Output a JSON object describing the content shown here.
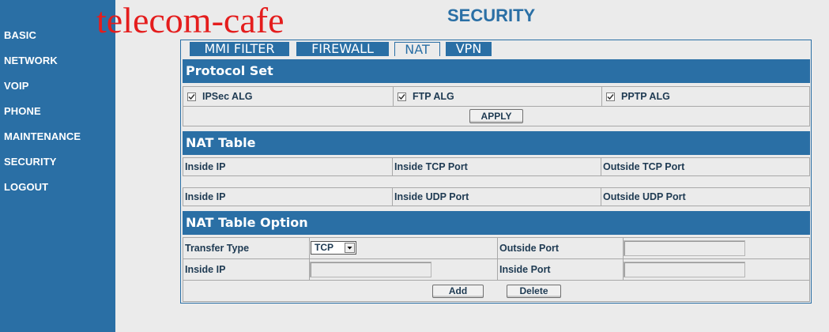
{
  "watermark": "telecom-cafe",
  "page_title": "SECURITY",
  "sidebar": {
    "items": [
      {
        "label": "BASIC"
      },
      {
        "label": "NETWORK"
      },
      {
        "label": "VOIP"
      },
      {
        "label": "PHONE"
      },
      {
        "label": "MAINTENANCE"
      },
      {
        "label": "SECURITY"
      },
      {
        "label": "LOGOUT"
      }
    ]
  },
  "tabs": [
    {
      "label": "MMI FILTER",
      "active": false
    },
    {
      "label": "FIREWALL",
      "active": false
    },
    {
      "label": "NAT",
      "active": true
    },
    {
      "label": "VPN",
      "active": false
    }
  ],
  "protocol_set": {
    "title": "Protocol Set",
    "options": [
      {
        "label": "IPSec ALG",
        "checked": true
      },
      {
        "label": "FTP ALG",
        "checked": true
      },
      {
        "label": "PPTP ALG",
        "checked": true
      }
    ],
    "apply_label": "APPLY"
  },
  "nat_table": {
    "title": "NAT Table",
    "tcp_headers": [
      "Inside IP",
      "Inside TCP Port",
      "Outside TCP Port"
    ],
    "udp_headers": [
      "Inside IP",
      "Inside UDP Port",
      "Outside UDP Port"
    ]
  },
  "nat_option": {
    "title": "NAT Table Option",
    "transfer_type_label": "Transfer Type",
    "transfer_type_value": "TCP",
    "outside_port_label": "Outside Port",
    "outside_port_value": "",
    "inside_ip_label": "Inside IP",
    "inside_ip_value": "",
    "inside_port_label": "Inside Port",
    "inside_port_value": "",
    "add_label": "Add",
    "delete_label": "Delete"
  },
  "colors": {
    "primary": "#2a6fa5",
    "background": "#ebebeb",
    "watermark": "#e41d1d"
  }
}
